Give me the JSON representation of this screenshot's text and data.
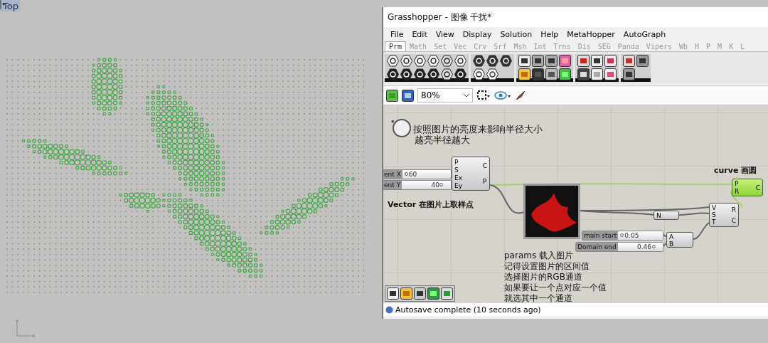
{
  "viewport": {
    "label": "Top",
    "axes": [
      "y",
      "x"
    ]
  },
  "window": {
    "title": "Grasshopper - 图像 干扰*",
    "menu": [
      "File",
      "Edit",
      "View",
      "Display",
      "Solution",
      "Help",
      "MetaHopper",
      "AutoGraph"
    ],
    "tabs": [
      {
        "label": "Prm",
        "selected": true
      },
      {
        "label": "Math",
        "selected": false
      },
      {
        "label": "Set",
        "selected": false
      },
      {
        "label": "Vec",
        "selected": false
      },
      {
        "label": "Crv",
        "selected": false
      },
      {
        "label": "Srf",
        "selected": false
      },
      {
        "label": "Msh",
        "selected": false
      },
      {
        "label": "Int",
        "selected": false
      },
      {
        "label": "Trns",
        "selected": false
      },
      {
        "label": "Dis",
        "selected": false
      },
      {
        "label": "SEG",
        "selected": false
      },
      {
        "label": "Panda",
        "selected": false
      },
      {
        "label": "Vipers",
        "selected": false
      },
      {
        "label": "Wb",
        "selected": false
      },
      {
        "label": "H",
        "selected": false
      },
      {
        "label": "P",
        "selected": false
      },
      {
        "label": "M",
        "selected": false
      },
      {
        "label": "K",
        "selected": false
      },
      {
        "label": "L",
        "selected": false
      }
    ],
    "zoom": "80%",
    "status": "Autosave complete (10 seconds ago)"
  },
  "canvas": {
    "notes": [
      {
        "kind": "cn",
        "lines": [
          "按照图片的亮度来影响半径大小",
          "越亮半径越大"
        ]
      },
      {
        "kind": "bold",
        "lines": [
          "Vector 在图片上取样点"
        ]
      },
      {
        "kind": "bold",
        "lines": [
          "curve 画圆"
        ]
      },
      {
        "kind": "mixed",
        "lines": [
          "params 载入图片",
          "记得设置图片的区间值",
          "选择图片的RGB通道",
          "如果要让一个点对应一个值",
          "就选其中一个通道"
        ]
      }
    ],
    "sliders": [
      {
        "label": "ent X",
        "value": "60",
        "level": 0.05
      },
      {
        "label": "ent Y",
        "value": "40",
        "level": 0.85
      },
      {
        "label": "main start",
        "value": "0.05",
        "level": 0.05
      },
      {
        "label": "Domain end",
        "value": "0.46",
        "level": 0.85
      }
    ],
    "components": [
      {
        "kind": "grey",
        "inputs": [
          "P",
          "S",
          "Ex",
          "Ey"
        ],
        "outputs": [
          "C",
          "P"
        ]
      },
      {
        "kind": "green",
        "inputs": [
          "P",
          "R"
        ],
        "outputs": [
          "C"
        ]
      },
      {
        "kind": "grey",
        "inputs": [
          "N"
        ]
      },
      {
        "kind": "grey",
        "inputs": [
          "V",
          "S",
          "T"
        ],
        "outputs": [
          "R",
          "C"
        ]
      },
      {
        "kind": "grey",
        "inputs": [
          "A",
          "B"
        ]
      }
    ]
  }
}
